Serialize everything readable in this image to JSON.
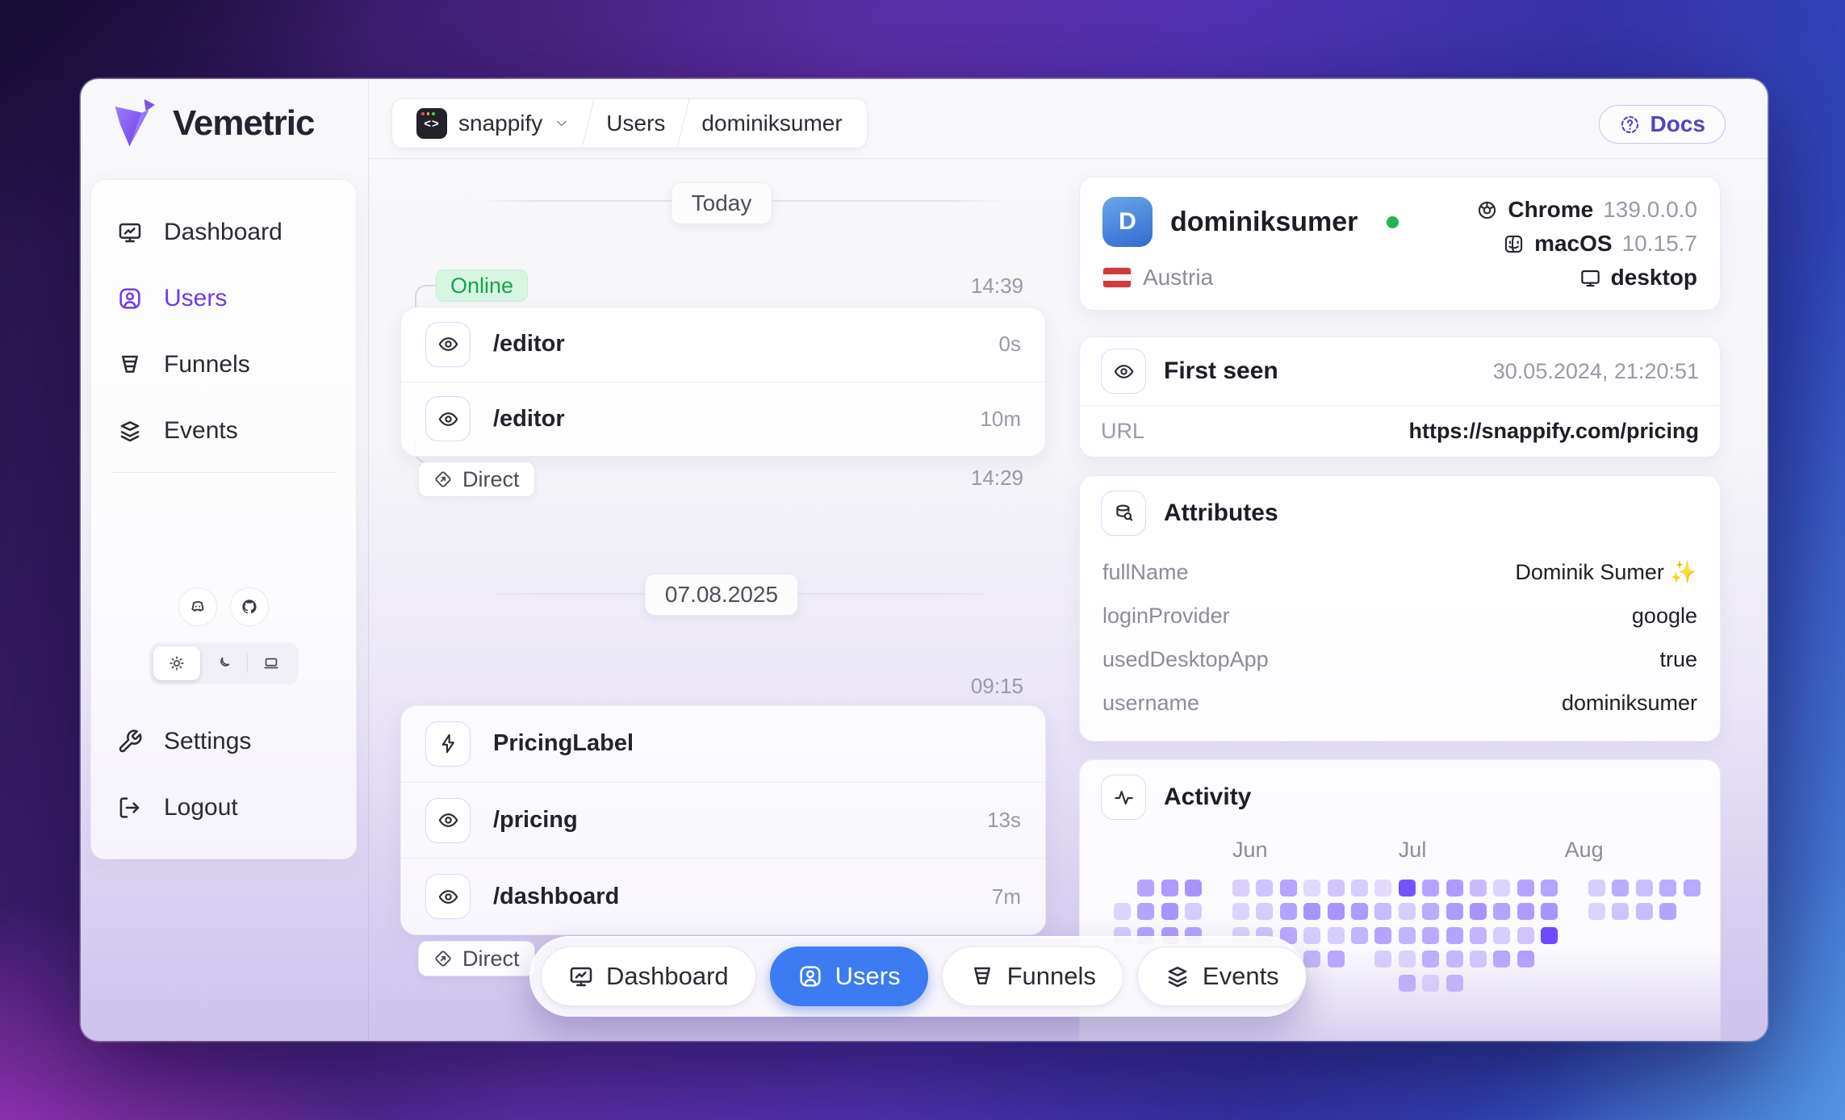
{
  "brand": {
    "name": "Vemetric"
  },
  "header": {
    "project": "snappify",
    "crumb_section": "Users",
    "crumb_user": "dominiksumer",
    "docs_label": "Docs"
  },
  "sidebar": {
    "items": [
      {
        "label": "Dashboard"
      },
      {
        "label": "Users"
      },
      {
        "label": "Funnels"
      },
      {
        "label": "Events"
      }
    ],
    "settings_label": "Settings",
    "logout_label": "Logout"
  },
  "timeline": {
    "today_label": "Today",
    "online_label": "Online",
    "session1": {
      "time": "14:39",
      "rows": [
        {
          "label": "/editor",
          "duration": "0s"
        },
        {
          "label": "/editor",
          "duration": "10m"
        }
      ],
      "source": "Direct",
      "source_time": "14:29"
    },
    "date_divider": "07.08.2025",
    "session2": {
      "time": "09:15",
      "rows": [
        {
          "label": "PricingLabel",
          "duration": ""
        },
        {
          "label": "/pricing",
          "duration": "13s"
        },
        {
          "label": "/dashboard",
          "duration": "7m"
        }
      ],
      "source": "Direct"
    }
  },
  "profile": {
    "initial": "D",
    "username": "dominiksumer",
    "browser": "Chrome",
    "browser_version": "139.0.0.0",
    "os": "macOS",
    "os_version": "10.15.7",
    "country": "Austria",
    "device": "desktop"
  },
  "first_seen": {
    "title": "First seen",
    "datetime": "30.05.2024, 21:20:51",
    "url_label": "URL",
    "url": "https://snappify.com/pricing"
  },
  "attributes": {
    "title": "Attributes",
    "rows": [
      {
        "key": "fullName",
        "value": "Dominik Sumer ✨"
      },
      {
        "key": "loginProvider",
        "value": "google"
      },
      {
        "key": "usedDesktopApp",
        "value": "true"
      },
      {
        "key": "username",
        "value": "dominiksumer"
      }
    ]
  },
  "activity": {
    "title": "Activity",
    "months": [
      {
        "label": "Jun",
        "col": 5
      },
      {
        "label": "Jul",
        "col": 12
      },
      {
        "label": "Aug",
        "col": 19
      }
    ],
    "heatmap": {
      "cols": 25,
      "rows": 5,
      "cell_color_rgb": "109,74,255",
      "grid": [
        [
          0,
          45,
          50,
          55,
          0,
          18,
          25,
          45,
          12,
          25,
          20,
          12,
          95,
          45,
          50,
          30,
          15,
          45,
          45,
          0,
          20,
          40,
          28,
          40,
          42
        ],
        [
          15,
          45,
          55,
          20,
          0,
          15,
          20,
          45,
          55,
          55,
          50,
          30,
          20,
          40,
          50,
          55,
          45,
          50,
          55,
          0,
          15,
          25,
          30,
          45,
          0
        ],
        [
          20,
          45,
          50,
          45,
          0,
          15,
          25,
          40,
          20,
          18,
          35,
          45,
          35,
          40,
          45,
          35,
          20,
          25,
          100,
          0,
          0,
          0,
          0,
          0,
          0
        ],
        [
          0,
          0,
          0,
          0,
          0,
          0,
          0,
          25,
          35,
          45,
          0,
          20,
          15,
          40,
          35,
          25,
          45,
          50,
          0,
          0,
          0,
          0,
          0,
          0,
          0
        ],
        [
          0,
          0,
          0,
          0,
          0,
          0,
          0,
          0,
          0,
          0,
          0,
          0,
          45,
          18,
          40,
          0,
          0,
          0,
          0,
          0,
          0,
          0,
          0,
          0,
          0
        ]
      ]
    }
  },
  "bottom_nav": {
    "items": [
      {
        "label": "Dashboard"
      },
      {
        "label": "Users"
      },
      {
        "label": "Funnels"
      },
      {
        "label": "Events"
      }
    ]
  },
  "colors": {
    "accent_purple": "#7139ee",
    "active_blue": "#3b7cf2",
    "online_green": "#17a34a",
    "heatmap_purple": "#6d4aff"
  }
}
